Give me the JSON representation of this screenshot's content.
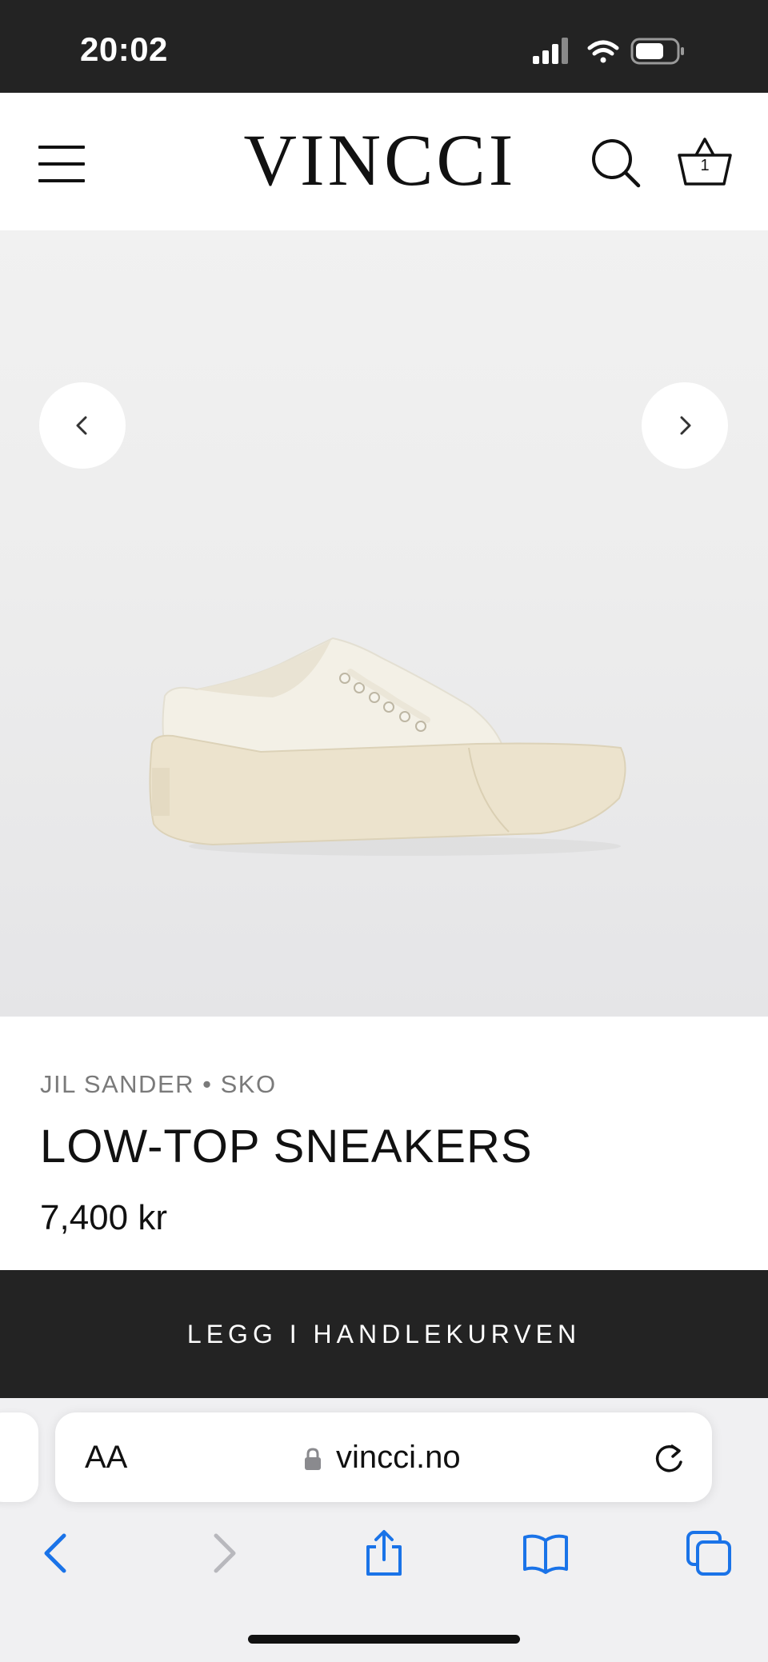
{
  "status_bar": {
    "time": "20:02"
  },
  "header": {
    "logo": "VINCCI",
    "cart_count": "1"
  },
  "product": {
    "breadcrumb": "JIL SANDER • SKO",
    "title": "LOW-TOP SNEAKERS",
    "price": "7,400 kr",
    "add_to_cart_label": "LEGG I HANDLEKURVEN"
  },
  "browser": {
    "text_size_label": "AA",
    "url": "vincci.no"
  },
  "icons": {
    "menu": "menu-icon",
    "search": "search-icon",
    "cart": "cart-icon",
    "prev": "chevron-left-icon",
    "next": "chevron-right-icon",
    "back": "back-arrow-icon",
    "forward": "forward-arrow-icon",
    "share": "share-icon",
    "bookmarks": "bookmarks-icon",
    "tabs": "tabs-icon"
  },
  "colors": {
    "dark": "#232323",
    "safari_blue": "#1a73e8",
    "muted_text": "#7a7a7a"
  }
}
